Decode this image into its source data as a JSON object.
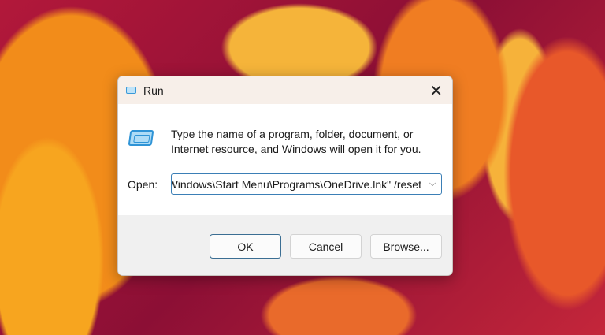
{
  "dialog": {
    "title": "Run",
    "description_line1": "Type the name of a program, folder, document, or",
    "description_line2": "Internet resource, and Windows will open it for you.",
    "open_label": "Open:",
    "open_value": "C:\\Windows\\Start Menu\\Programs\\OneDrive.lnk\" /reset",
    "close": "✕",
    "dropdown": "⌵",
    "ok": "OK",
    "cancel": "Cancel",
    "browse": "Browse..."
  }
}
